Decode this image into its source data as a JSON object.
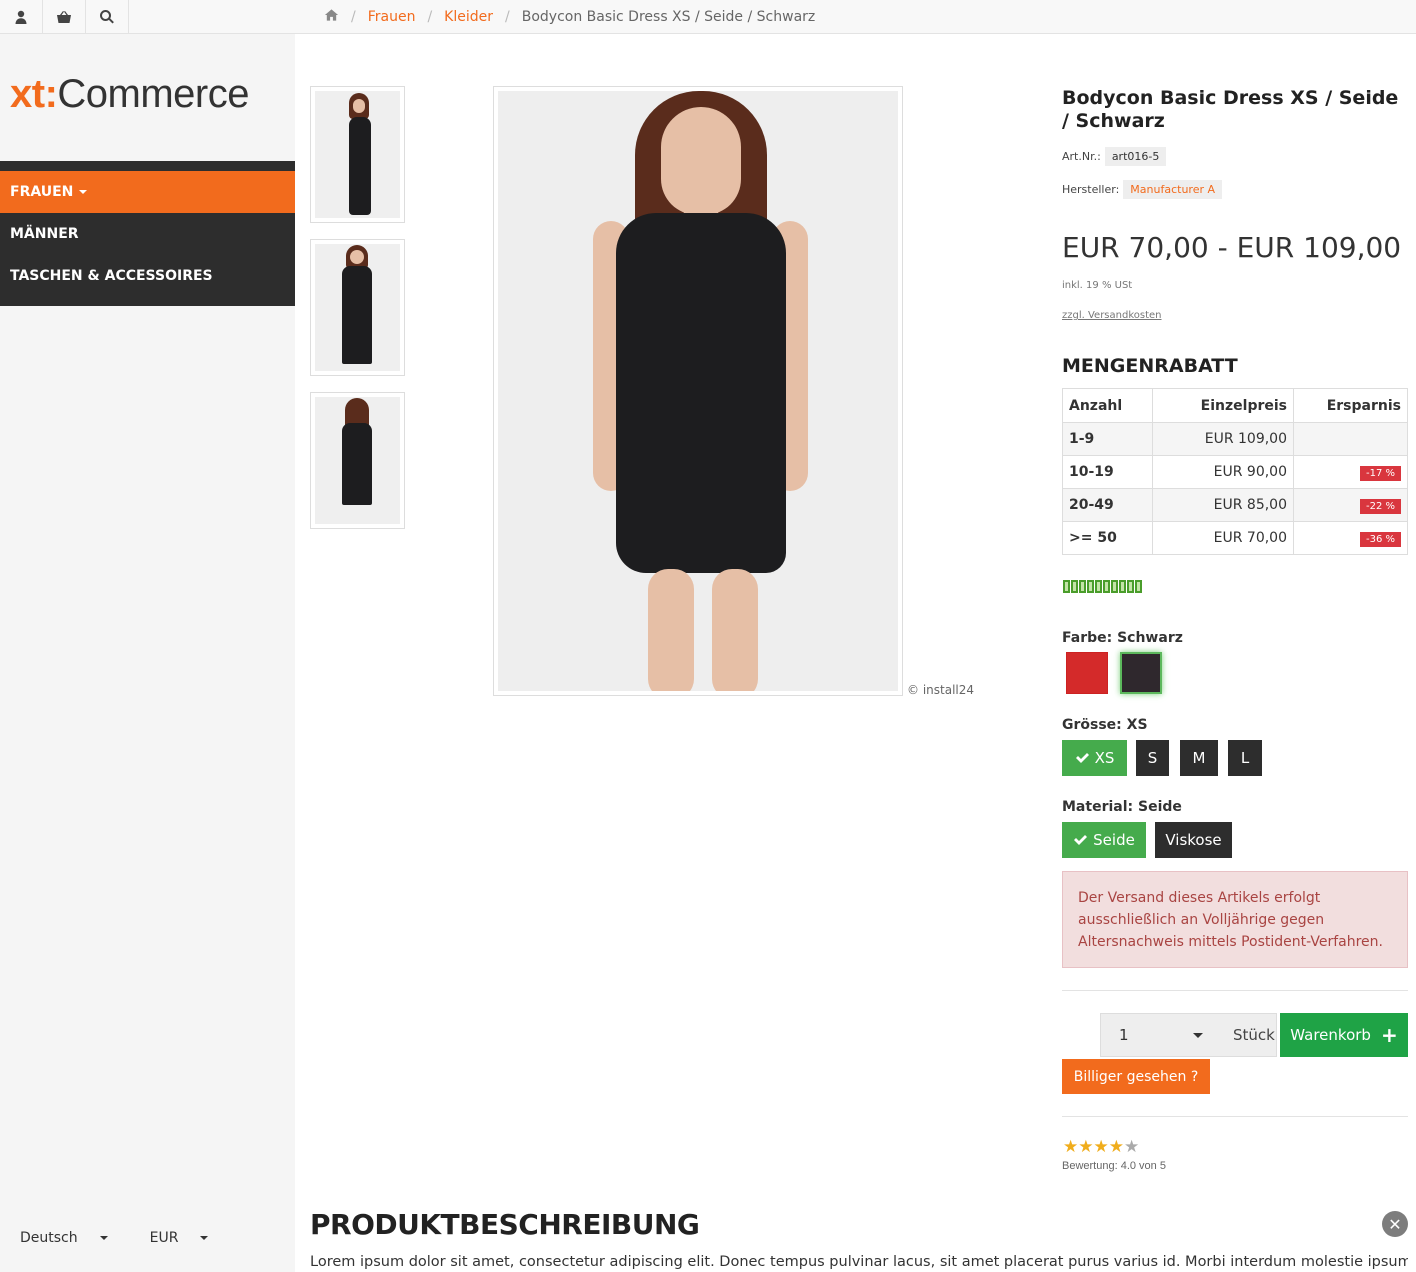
{
  "topbar": {
    "icons": [
      "user-icon",
      "basket-icon",
      "search-icon"
    ]
  },
  "breadcrumb": {
    "items": [
      "Frauen",
      "Kleider"
    ],
    "current": "Bodycon Basic Dress XS / Seide / Schwarz"
  },
  "sidebar": {
    "logo": {
      "part1": "xt:",
      "part2": "Commerce"
    },
    "nav": [
      {
        "label": "FRAUEN",
        "active": true
      },
      {
        "label": "MÄNNER",
        "active": false
      },
      {
        "label": "TASCHEN & ACCESSOIRES",
        "active": false
      }
    ],
    "language": "Deutsch",
    "currency": "EUR"
  },
  "gallery": {
    "copyright": "© install24"
  },
  "product": {
    "title": "Bodycon Basic Dress XS / Seide / Schwarz",
    "artnr_label": "Art.Nr.:",
    "artnr": "art016-5",
    "manufacturer_label": "Hersteller:",
    "manufacturer": "Manufacturer A",
    "price_range": "EUR 70,00 - EUR 109,00",
    "tax_note": "inkl. 19 % USt",
    "shipping_link": "zzgl. Versandkosten"
  },
  "mengenrabatt": {
    "heading": "MENGENRABATT",
    "headers": [
      "Anzahl",
      "Einzelpreis",
      "Ersparnis"
    ],
    "rows": [
      {
        "qty": "1-9",
        "price": "EUR 109,00",
        "saving": ""
      },
      {
        "qty": "10-19",
        "price": "EUR 90,00",
        "saving": "-17 %"
      },
      {
        "qty": "20-49",
        "price": "EUR 85,00",
        "saving": "-22 %"
      },
      {
        "qty": ">= 50",
        "price": "EUR 70,00",
        "saving": "-36 %"
      }
    ]
  },
  "options": {
    "color_label": "Farbe: Schwarz",
    "colors": [
      {
        "name": "red",
        "hex": "#d42a2a"
      },
      {
        "name": "black",
        "hex": "#2f282d"
      }
    ],
    "size_label": "Grösse: XS",
    "sizes": [
      "XS",
      "S",
      "M",
      "L"
    ],
    "material_label": "Material: Seide",
    "materials": [
      "Seide",
      "Viskose"
    ]
  },
  "alert": {
    "text": "Der Versand dieses Artikels erfolgt ausschließlich an Volljährige gegen Altersnachweis mittels Postident-Verfahren."
  },
  "cart": {
    "quantity": "1",
    "unit": "Stück",
    "button": "Warenkorb",
    "cheaper_button": "Billiger gesehen ?"
  },
  "rating": {
    "value": 4,
    "max": 5,
    "text": "Bewertung: 4.0 von 5"
  },
  "description": {
    "heading": "PRODUKTBESCHREIBUNG",
    "text": "Lorem ipsum dolor sit amet, consectetur adipiscing elit. Donec tempus pulvinar lacus, sit amet placerat purus varius id. Morbi interdum molestie ipsum nec iacu-"
  },
  "colors": {
    "accent": "#f26b1d",
    "nav_bg": "#2d2d2d",
    "success": "#45ab4c",
    "cart_green": "#1fa346",
    "danger": "#d9363e"
  }
}
